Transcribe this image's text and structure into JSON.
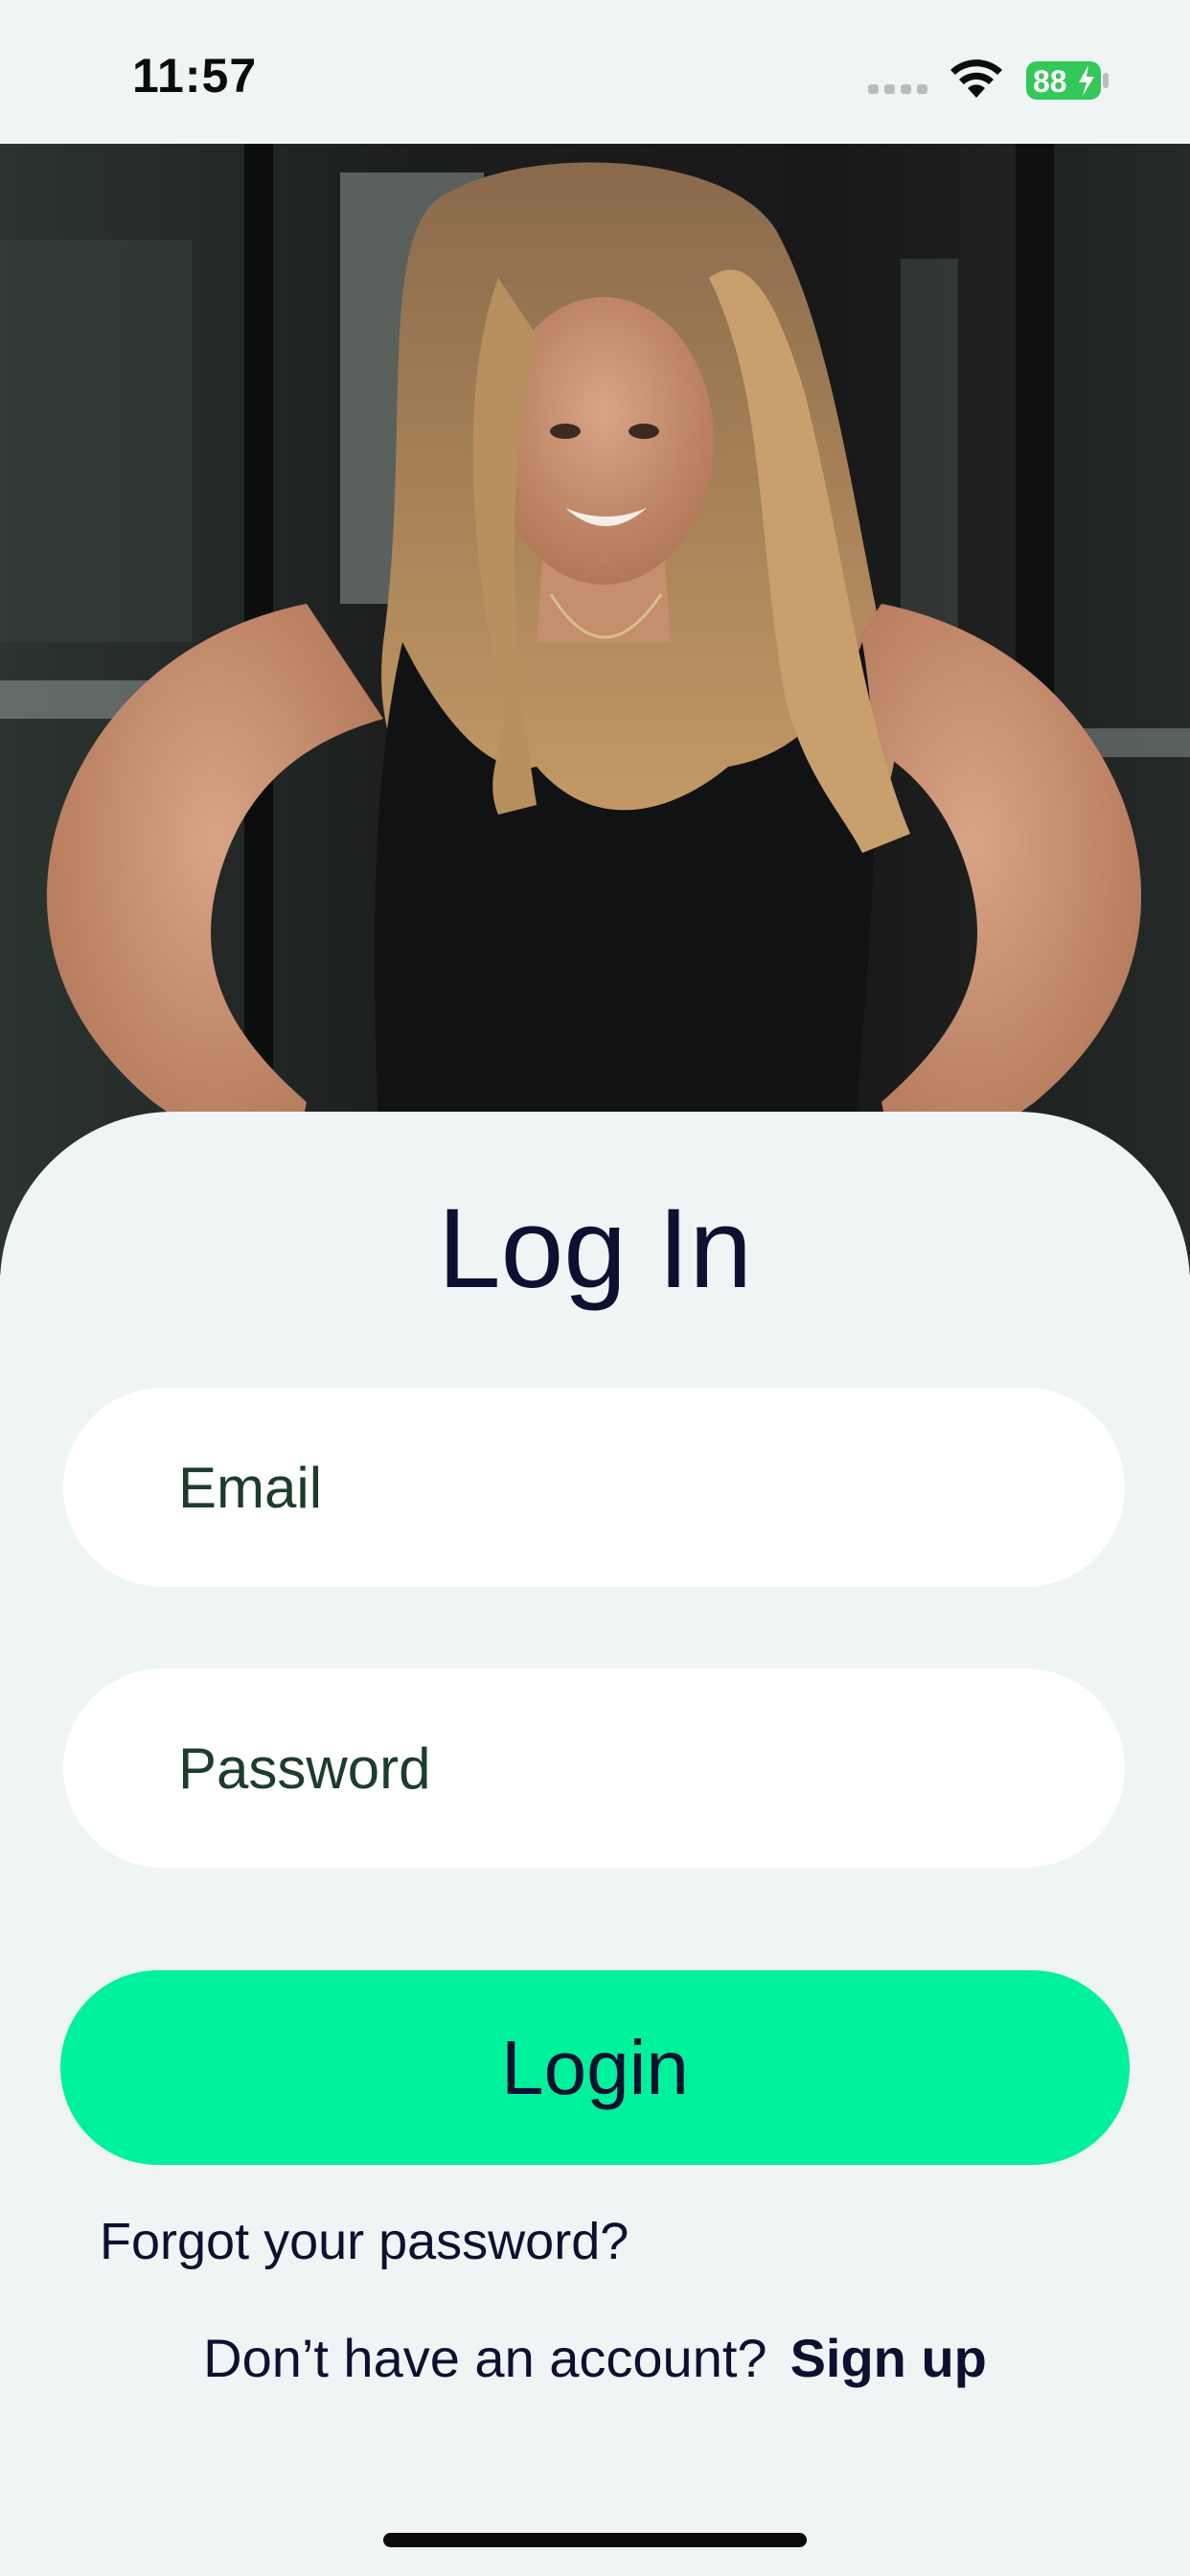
{
  "status_bar": {
    "time": "11:57",
    "battery_level": 88,
    "battery_charging": true,
    "battery_color": "#34c759",
    "icons": [
      "cellular-signal-icon",
      "wifi-icon",
      "battery-charging-icon"
    ]
  },
  "hero": {
    "image": "photo of smiling woman with long hair in black tank top, hands on hips, in a gym"
  },
  "login": {
    "title": "Log In",
    "email_placeholder": "Email",
    "password_placeholder": "Password",
    "login_button_label": "Login",
    "forgot_password_label": "Forgot your password?",
    "no_account_text": "Don’t have an account?",
    "sign_up_label": "Sign up"
  },
  "colors": {
    "background": "#eef5f4",
    "accent": "#00f19c",
    "text": "#0d1030",
    "placeholder": "#1d3d2c"
  }
}
